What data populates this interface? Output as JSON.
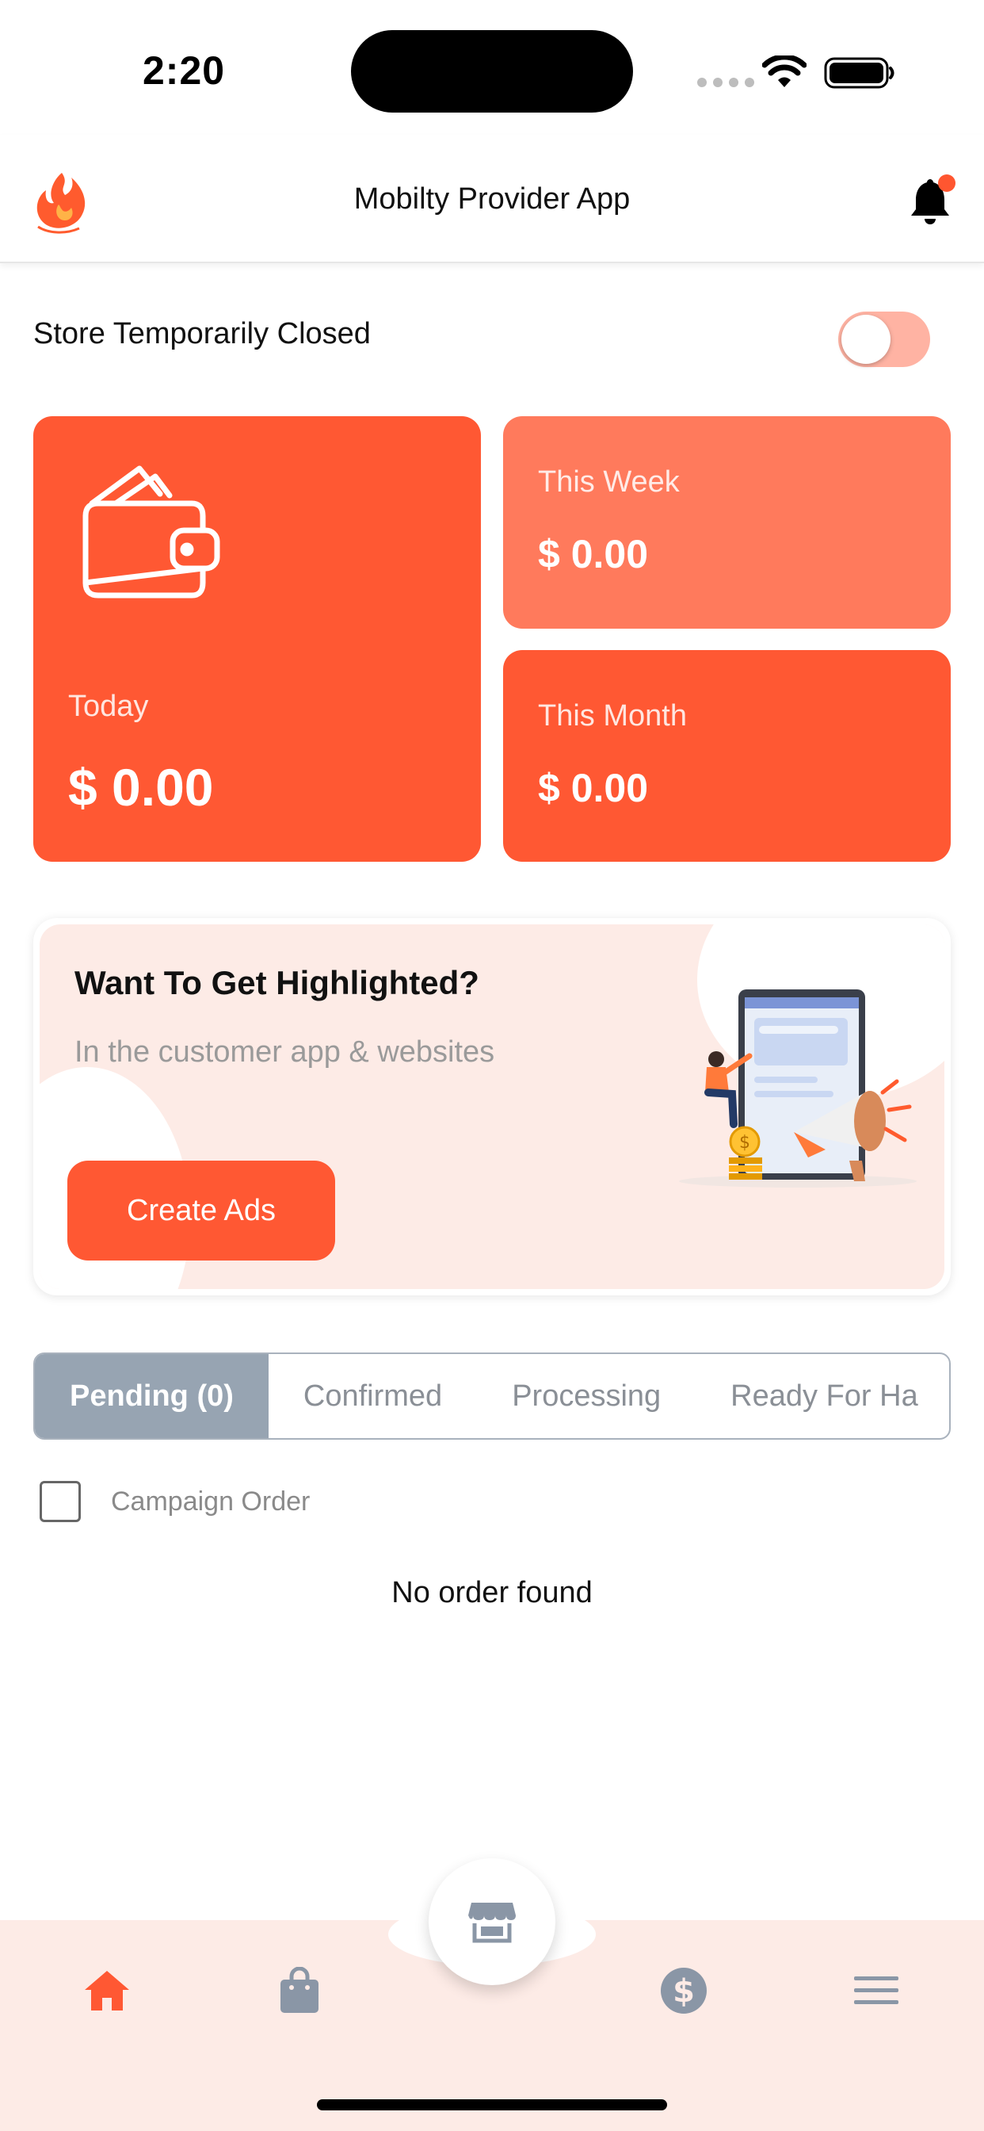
{
  "status_bar": {
    "time": "2:20"
  },
  "header": {
    "title": "Mobilty Provider App",
    "logo_icon": "flame-logo-icon",
    "notification_icon": "bell-icon"
  },
  "store": {
    "label": "Store Temporarily Closed",
    "toggle_on": false
  },
  "earnings": {
    "today": {
      "label": "Today",
      "amount": "$ 0.00",
      "icon": "wallet-icon"
    },
    "week": {
      "label": "This Week",
      "amount": "$ 0.00"
    },
    "month": {
      "label": "This Month",
      "amount": "$ 0.00"
    }
  },
  "promo": {
    "title": "Want To Get Highlighted?",
    "subtitle": "In the customer app & websites",
    "button_label": "Create Ads"
  },
  "tabs": [
    {
      "label": "Pending (0)",
      "active": true
    },
    {
      "label": "Confirmed",
      "active": false
    },
    {
      "label": "Processing",
      "active": false
    },
    {
      "label": "Ready For Ha",
      "active": false
    }
  ],
  "campaign": {
    "label": "Campaign Order",
    "checked": false
  },
  "orders": {
    "empty_message": "No order found"
  },
  "bottom_nav": {
    "items": [
      "home-icon",
      "shopping-bag-icon",
      "store-icon",
      "dollar-icon",
      "menu-icon"
    ],
    "active": "home-icon"
  },
  "colors": {
    "accent": "#ff5833",
    "accent_light": "#ff7a5c",
    "tab_active": "#97a4b2",
    "nav_bg": "#fdebe6"
  }
}
